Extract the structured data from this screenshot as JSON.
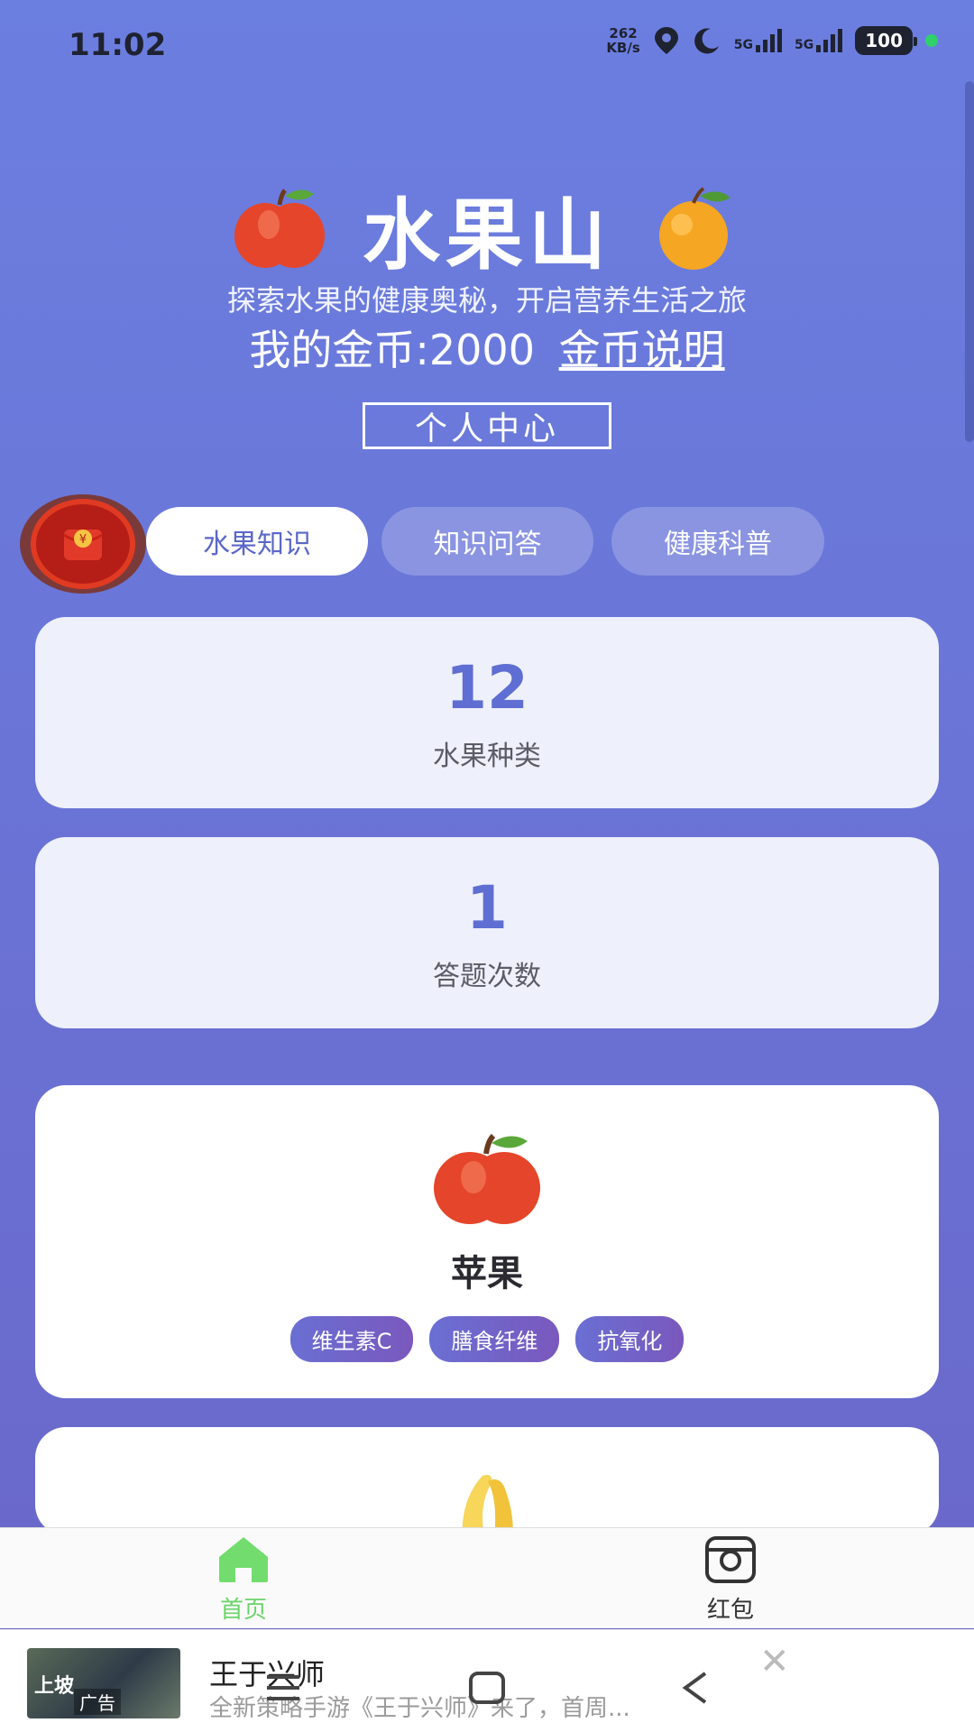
{
  "status_bar": {
    "time": "11:02",
    "net_speed_value": "262",
    "net_speed_unit": "KB/s",
    "signal_1": "5G",
    "signal_2": "5G",
    "battery": "100",
    "icons": [
      "location-icon",
      "moon-icon",
      "signal-icon",
      "battery-icon"
    ]
  },
  "header": {
    "title": "水果山",
    "subtitle": "探索水果的健康奥秘，开启营养生活之旅",
    "coin_text": "我的金币:2000",
    "coin_link": "金币说明",
    "profile_button": "个人中心"
  },
  "tabs": [
    {
      "label": "水果知识",
      "active": true
    },
    {
      "label": "知识问答",
      "active": false
    },
    {
      "label": "健康科普",
      "active": false
    }
  ],
  "stats": [
    {
      "value": "12",
      "label": "水果种类"
    },
    {
      "value": "1",
      "label": "答题次数"
    }
  ],
  "fruits": [
    {
      "icon": "apple-icon",
      "name": "苹果",
      "tags": [
        "维生素C",
        "膳食纤维",
        "抗氧化"
      ]
    },
    {
      "icon": "banana-icon"
    }
  ],
  "bottom_nav": {
    "items": [
      {
        "label": "首页",
        "icon": "home-icon",
        "active": true
      },
      {
        "label": "红包",
        "icon": "camera-icon",
        "active": false
      }
    ],
    "active_color": "#6cd36b"
  },
  "ad": {
    "thumb_text": "上坡",
    "badge": "广告",
    "title": "王于兴师",
    "description": "全新策略手游《王于兴师》来了，首周..."
  },
  "colors": {
    "accent": "#5f6ed2",
    "background_top": "#6b7fe0",
    "background_bottom": "#6a66c8"
  }
}
